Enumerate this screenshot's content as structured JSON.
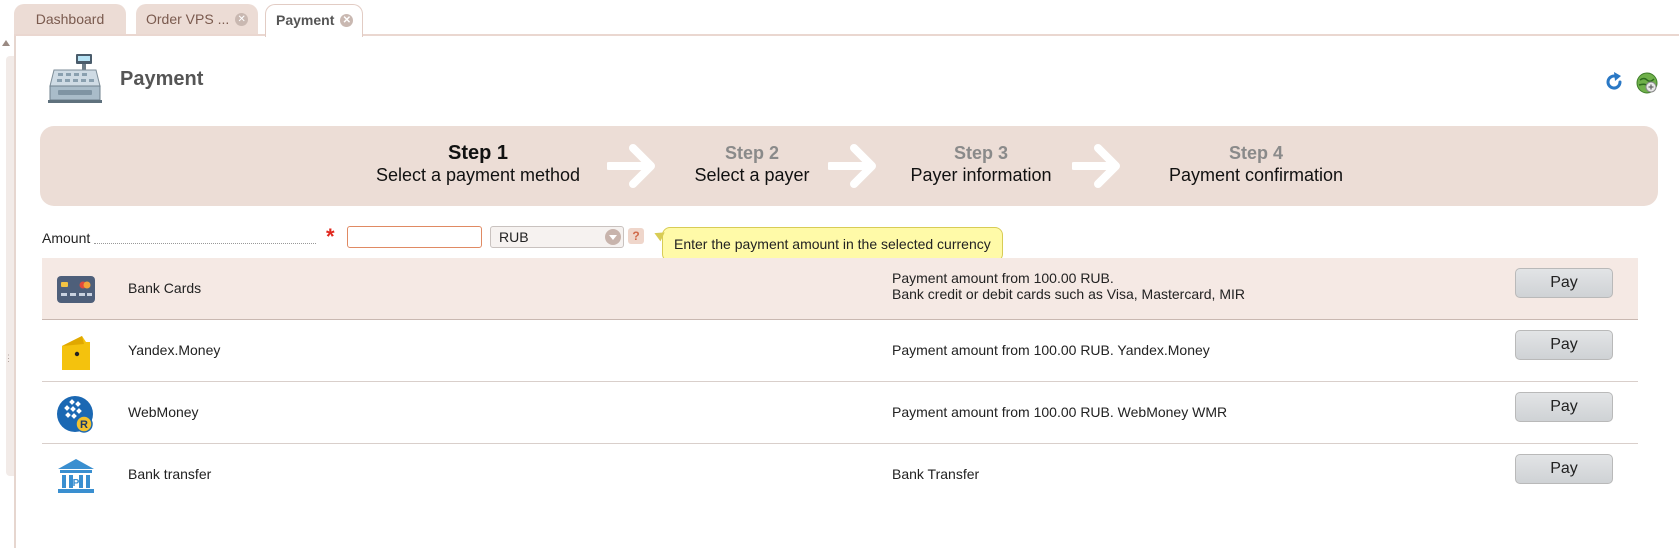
{
  "tabs": [
    {
      "label": "Dashboard",
      "closable": false,
      "active": false
    },
    {
      "label": "Order VPS ...",
      "closable": true,
      "active": false
    },
    {
      "label": "Payment",
      "closable": true,
      "active": true
    }
  ],
  "header": {
    "title": "Payment",
    "icon": "cash-register-icon",
    "actions": [
      "refresh-icon",
      "globe-icon"
    ]
  },
  "steps": [
    {
      "number": "Step 1",
      "label": "Select a payment method",
      "current": true
    },
    {
      "number": "Step 2",
      "label": "Select a payer",
      "current": false
    },
    {
      "number": "Step 3",
      "label": "Payer information",
      "current": false
    },
    {
      "number": "Step 4",
      "label": "Payment confirmation",
      "current": false
    }
  ],
  "amount": {
    "label": "Amount",
    "required_mark": "*",
    "value": "",
    "currency": "RUB",
    "help": "?",
    "tooltip": "Enter the payment amount in the selected currency"
  },
  "methods": [
    {
      "name": "Bank Cards",
      "icon": "bank-card-icon",
      "description": [
        "Payment amount from 100.00 RUB.",
        "Bank credit or debit cards such as Visa, Mastercard, MIR"
      ],
      "action": "Pay"
    },
    {
      "name": "Yandex.Money",
      "icon": "yandex-money-icon",
      "description": [
        "Payment amount from 100.00 RUB. Yandex.Money"
      ],
      "action": "Pay"
    },
    {
      "name": "WebMoney",
      "icon": "webmoney-icon",
      "description": [
        "Payment amount from 100.00 RUB. WebMoney WMR"
      ],
      "action": "Pay"
    },
    {
      "name": "Bank transfer",
      "icon": "bank-building-icon",
      "description": [
        "Bank Transfer"
      ],
      "action": "Pay"
    }
  ],
  "colors": {
    "accent_bg": "#ecddd6",
    "highlight_row": "#f5e9e4",
    "required": "#e0281e",
    "tooltip_bg": "#fffaa8"
  }
}
